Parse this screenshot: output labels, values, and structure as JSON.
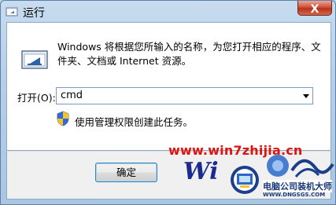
{
  "window": {
    "title": "运行",
    "close_label": "X"
  },
  "dialog": {
    "description": "Windows 将根据您所输入的名称，为您打开相应的程序、文件夹、文档或 Internet 资源。",
    "open_label": "打开(O):",
    "command_value": "cmd",
    "admin_note": "使用管理权限创建此任务。"
  },
  "buttons": {
    "ok_label": "确定"
  },
  "watermark": {
    "url": "www.win7zhijia.cn",
    "logo_text": "Wi",
    "brand_name": "电脑公司装机大师",
    "brand_url": "WWW.DNGSGS.COM"
  },
  "colors": {
    "watermark_red": "#e0140f",
    "title_bar": "#b9d3ea",
    "ok_focus": "#3c7fb1"
  }
}
